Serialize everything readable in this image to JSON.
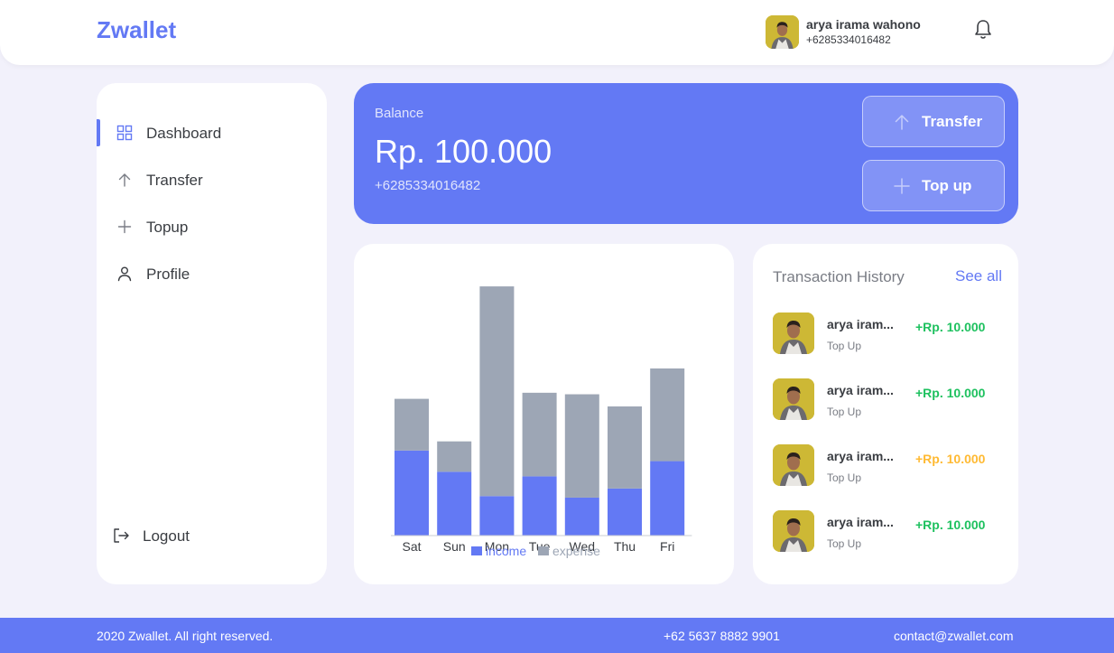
{
  "header": {
    "brand": "Zwallet",
    "user": {
      "name": "arya irama wahono",
      "phone": "+6285334016482"
    },
    "notification_icon": "bell-icon"
  },
  "sidebar": {
    "items": [
      {
        "label": "Dashboard",
        "icon": "grid-icon",
        "active": true
      },
      {
        "label": "Transfer",
        "icon": "arrow-up-icon",
        "active": false
      },
      {
        "label": "Topup",
        "icon": "plus-icon",
        "active": false
      },
      {
        "label": "Profile",
        "icon": "user-icon",
        "active": false
      }
    ],
    "logout": {
      "label": "Logout",
      "icon": "logout-icon"
    }
  },
  "balance": {
    "label": "Balance",
    "amount": "Rp. 100.000",
    "phone": "+6285334016482",
    "transfer_label": "Transfer",
    "topup_label": "Top up"
  },
  "chart_data": {
    "type": "bar",
    "stacked": true,
    "categories": [
      "Sat",
      "Sun",
      "Mon",
      "Tue",
      "Wed",
      "Thu",
      "Fri"
    ],
    "series": [
      {
        "name": "income",
        "color": "#6379f4",
        "values": [
          5.6,
          4.2,
          2.6,
          3.9,
          2.5,
          3.1,
          4.9
        ]
      },
      {
        "name": "expense",
        "color": "#9da6b5",
        "values": [
          3.4,
          2.0,
          13.8,
          5.5,
          6.8,
          5.4,
          6.1
        ]
      }
    ],
    "title": "",
    "xlabel": "",
    "ylabel": "",
    "ylim": [
      0,
      17
    ],
    "legend": "bottom-center",
    "grid": false
  },
  "history": {
    "title": "Transaction History",
    "see_all": "See all",
    "items": [
      {
        "name": "arya iram...",
        "type": "Top Up",
        "amount": "+Rp. 10.000",
        "color": "#1ec15f"
      },
      {
        "name": "arya iram...",
        "type": "Top Up",
        "amount": "+Rp. 10.000",
        "color": "#1ec15f"
      },
      {
        "name": "arya iram...",
        "type": "Top Up",
        "amount": "+Rp. 10.000",
        "color": "#ffba33"
      },
      {
        "name": "arya iram...",
        "type": "Top Up",
        "amount": "+Rp. 10.000",
        "color": "#1ec15f"
      }
    ]
  },
  "footer": {
    "copyright": "2020 Zwallet. All right reserved.",
    "phone": "+62 5637 8882 9901",
    "email": "contact@zwallet.com"
  },
  "colors": {
    "primary": "#6379f4",
    "background": "#f2f1fb",
    "success": "#1ec15f",
    "warning": "#ffba33"
  }
}
